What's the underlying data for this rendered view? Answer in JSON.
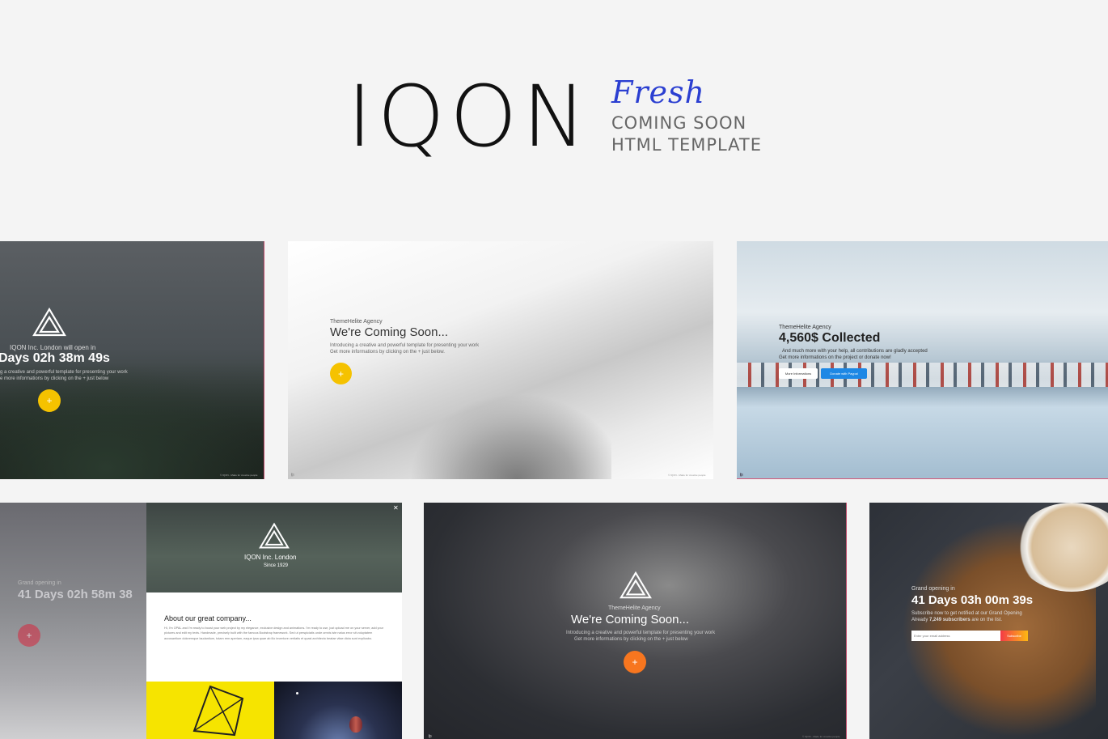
{
  "header": {
    "brand": "IQON",
    "script": "Fresh",
    "line1": "COMING SOON",
    "line2": "HTML TEMPLATE"
  },
  "card1": {
    "eyebrow": "IQON Inc. London will open in",
    "countdown": "Days 02h 38m 49s",
    "desc1": "g a creative and powerful template for presenting your work",
    "desc2": "e more informations by clicking on the + just below",
    "footer": "© IQON - Made for creative people"
  },
  "card2": {
    "eyebrow": "ThemeHelite Agency",
    "title": "We're Coming Soon...",
    "desc1": "Introducing a creative and powerful template for presenting your work",
    "desc2": "Get more informations by clicking on the + just below.",
    "footer": "© IQON - Made for creative people"
  },
  "card3": {
    "eyebrow": "ThemeHelite Agency",
    "title": "4,560$ Collected",
    "desc1": "And much more with your help, all contributions are gladly accepted",
    "desc2": "Get more informations on the project or donate now!",
    "btn1": "More Informations",
    "btn2": "Donate with Paypal"
  },
  "card4": {
    "eyebrow": "Grand opening in",
    "countdown": "41 Days 02h 58m 38",
    "company": "IQON Inc. London",
    "since": "Since 1929",
    "close": "✕",
    "about_title": "About our great company...",
    "about_text": "Hi, I'm OPAL and I'm ready to boost your web project by my elegance, exclusive design and animations. I'm ready to use, just upload me on your server, add your pictures and edit my texts. Handmade, precisely built with the famous Bootstrap framework. Sed ut perspiciatis unde omnis iste natus error sit voluptatem accusantium doloremque laudantium, totam rem aperiam, eaque ipsa quae ab illo inventore veritatis et quasi architecto beatae vitae dicta sunt explicabo."
  },
  "card5": {
    "eyebrow": "ThemeHelite Agency",
    "title": "We're Coming Soon...",
    "desc1": "Introducing a creative and powerful template for presenting your work",
    "desc2": "Get more informations by clicking on the + just below",
    "footer": "© IQON - Made for creative people"
  },
  "card6": {
    "eyebrow": "Grand opening in",
    "countdown": "41 Days 03h 00m 39s",
    "desc1": "Subscribe now to get notified at our Grand Opening",
    "desc2_pre": "Already ",
    "desc2_bold": "7,249 subscribers",
    "desc2_post": " are on the list.",
    "email_placeholder": "Enter your email address",
    "subscribe": "Subscribe"
  },
  "colors": {
    "script": "#2b3fd1",
    "yellow": "#f5c200",
    "orange": "#f7761f",
    "red": "#d7263d",
    "blue": "#1e88e5"
  }
}
